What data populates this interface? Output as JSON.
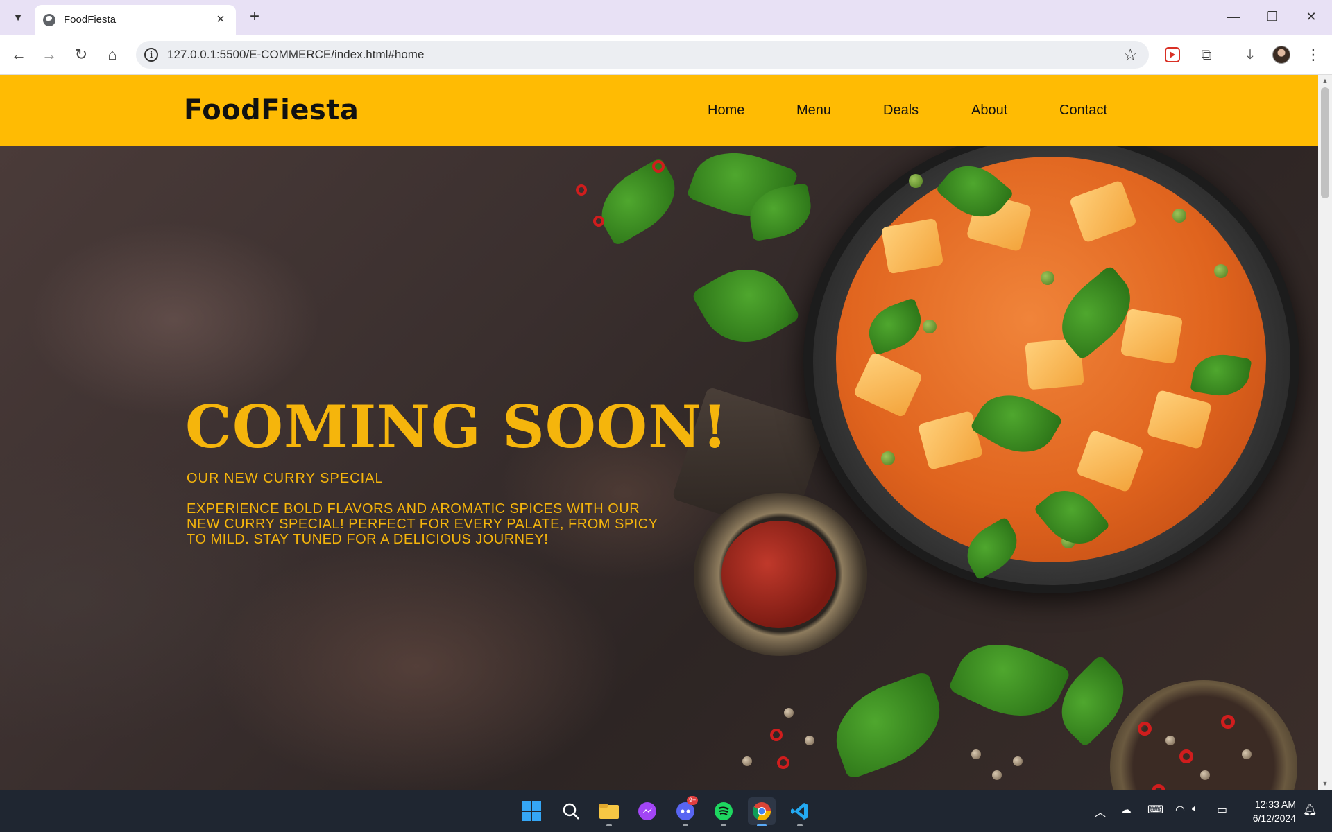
{
  "browser": {
    "tab_title": "FoodFiesta",
    "new_tab_label": "+",
    "close_tab_label": "×",
    "url": "127.0.0.1:5500/E-COMMERCE/index.html#home",
    "window_controls": {
      "minimize": "—",
      "restore": "❐",
      "close": "✕"
    }
  },
  "site": {
    "logo": "FoodFiesta",
    "nav": [
      "Home",
      "Menu",
      "Deals",
      "About",
      "Contact"
    ],
    "accent_color": "#ffbb03",
    "hero": {
      "title": "COMING SOON!",
      "subtitle": "OUR NEW CURRY SPECIAL",
      "description": "EXPERIENCE BOLD FLAVORS AND AROMATIC SPICES WITH OUR NEW CURRY SPECIAL! PERFECT FOR EVERY PALATE, FROM SPICY TO MILD. STAY TUNED FOR A DELICIOUS JOURNEY!",
      "text_color": "#f5b50c"
    }
  },
  "taskbar": {
    "apps": [
      "start-icon",
      "search-icon",
      "file-explorer-icon",
      "messenger-icon",
      "discord-icon",
      "spotify-icon",
      "chrome-icon",
      "vscode-icon"
    ],
    "discord_badge": "9+",
    "time": "12:33 AM",
    "date": "6/12/2024"
  }
}
